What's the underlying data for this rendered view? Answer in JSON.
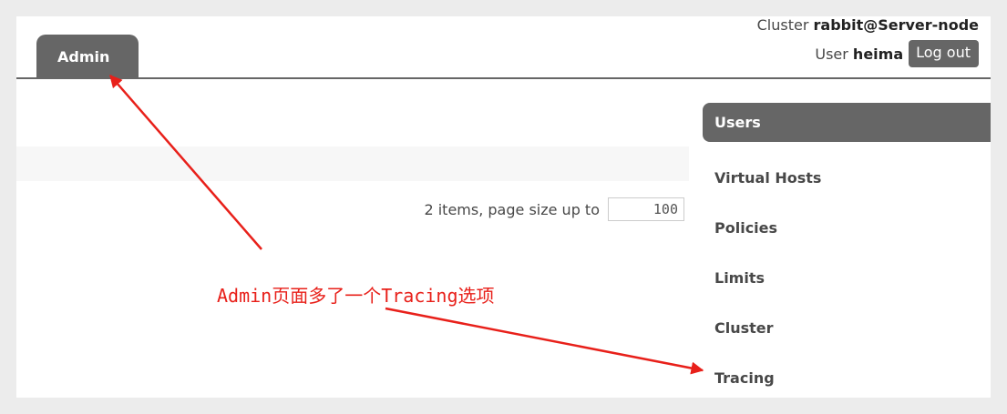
{
  "header": {
    "tab_admin": "Admin",
    "cluster_prefix": "Cluster",
    "cluster_name": "rabbit@Server-node",
    "user_prefix": "User",
    "user_name": "heima",
    "logout_label": "Log out"
  },
  "main": {
    "pagination_text": "2 items, page size up to",
    "page_size_value": "100"
  },
  "sidebar": {
    "items": [
      {
        "label": "Users",
        "active": true
      },
      {
        "label": "Virtual Hosts",
        "active": false
      },
      {
        "label": "Policies",
        "active": false
      },
      {
        "label": "Limits",
        "active": false
      },
      {
        "label": "Cluster",
        "active": false
      },
      {
        "label": "Tracing",
        "active": false
      }
    ]
  },
  "annotation": {
    "text": "Admin页面多了一个Tracing选项",
    "color": "#e8201a"
  },
  "colors": {
    "tab_bg": "#666666",
    "panel_bg": "#ffffff",
    "page_bg": "#ececec"
  }
}
